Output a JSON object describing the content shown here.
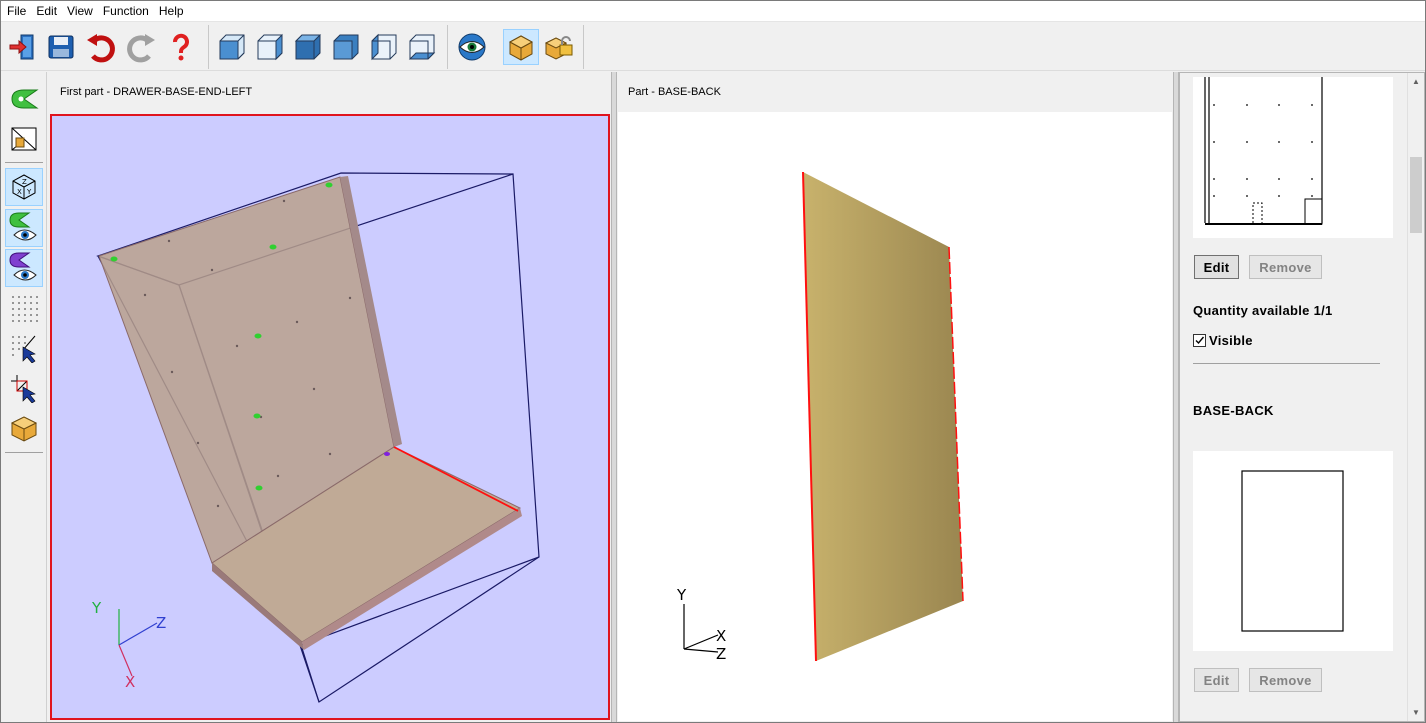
{
  "menubar": {
    "items": [
      "File",
      "Edit",
      "View",
      "Function",
      "Help"
    ]
  },
  "toolbar": {
    "icons": [
      "exit-icon",
      "save-icon",
      "undo-icon",
      "redo-icon",
      "help-icon",
      "cube-view-1-icon",
      "cube-view-2-icon",
      "cube-view-3-icon",
      "cube-view-4-icon",
      "cube-view-5-icon",
      "cube-view-6-icon",
      "eye-view-icon",
      "box-icon",
      "lock-box-icon"
    ]
  },
  "left_tools": {
    "icons": [
      "green-marker-icon",
      "select-area-icon",
      "axes-cube-icon",
      "green-marker-eye-icon",
      "purple-marker-eye-icon",
      "grid-dots-icon",
      "grid-pointer-icon",
      "crosshair-pointer-icon",
      "box-icon"
    ]
  },
  "viewport_left": {
    "title": "First part - DRAWER-BASE-END-LEFT",
    "axis_labels": {
      "y": "Y",
      "z": "Z",
      "x": "X"
    }
  },
  "viewport_right": {
    "title": "Part - BASE-BACK",
    "axis_labels": {
      "y": "Y",
      "x": "X",
      "z": "Z"
    }
  },
  "right_panel": {
    "first_edit_label": "Edit",
    "first_remove_label": "Remove",
    "quantity_text": "Quantity available 1/1",
    "visible_label": "Visible",
    "visible_checked": true,
    "part_name": "BASE-BACK",
    "second_edit_label": "Edit",
    "second_remove_label": "Remove"
  },
  "colors": {
    "accent_selection": "#cce8ff",
    "viewport_bg": "#ccccff",
    "highlight_edge": "#e0141e",
    "panel_fill": "#b09060"
  }
}
